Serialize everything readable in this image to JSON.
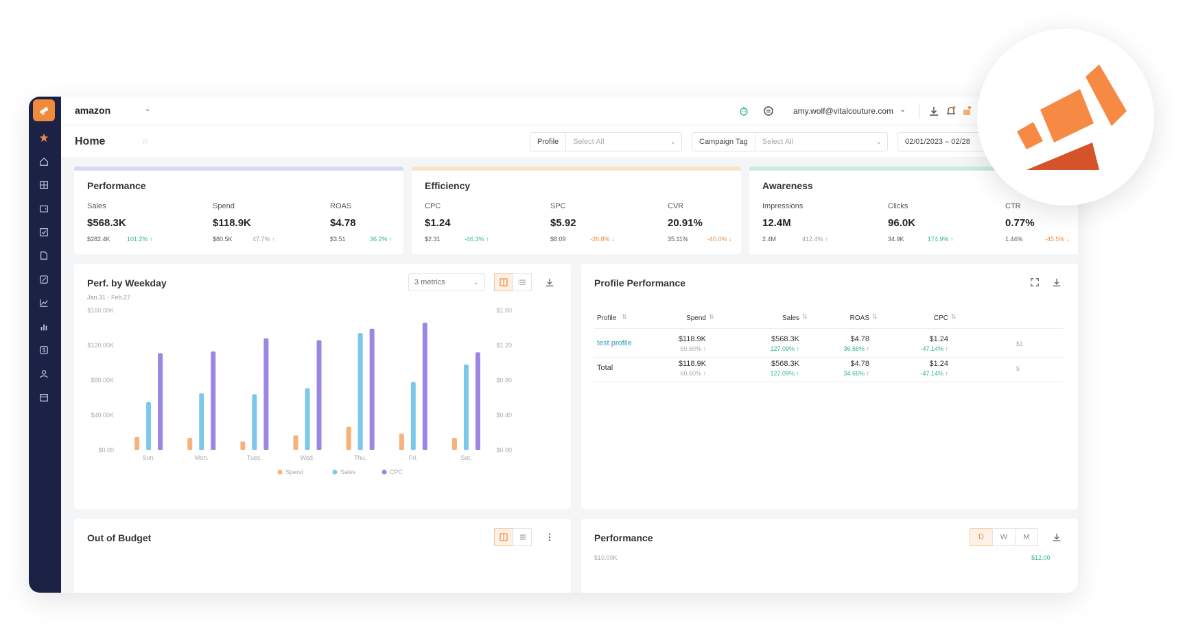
{
  "topbar": {
    "brand": "amazon",
    "email": "amy.wolf@vitalcouture.com"
  },
  "subbar": {
    "title": "Home",
    "filters": [
      {
        "label": "Profile",
        "value": "Select All"
      },
      {
        "label": "Campaign Tag",
        "value": "Select All"
      }
    ],
    "date_range": "02/01/2023 – 02/28"
  },
  "kpi_cards": [
    {
      "title": "Performance",
      "strip_color": "#d9d8f2",
      "metrics": [
        {
          "label": "Sales",
          "value": "$568.3K",
          "prev": "$282.4K",
          "change": "101.2%",
          "dir": "up"
        },
        {
          "label": "Spend",
          "value": "$118.9K",
          "prev": "$80.5K",
          "change": "47.7%",
          "dir": "neutral"
        },
        {
          "label": "ROAS",
          "value": "$4.78",
          "prev": "$3.51",
          "change": "36.2%",
          "dir": "up"
        }
      ]
    },
    {
      "title": "Efficiency",
      "strip_color": "#fbe3c9",
      "metrics": [
        {
          "label": "CPC",
          "value": "$1.24",
          "prev": "$2.31",
          "change": "-46.3%",
          "dir": "up"
        },
        {
          "label": "SPC",
          "value": "$5.92",
          "prev": "$8.09",
          "change": "-26.8%",
          "dir": "down"
        },
        {
          "label": "CVR",
          "value": "20.91%",
          "prev": "35.11%",
          "change": "-40.0%",
          "dir": "down"
        }
      ]
    },
    {
      "title": "Awareness",
      "strip_color": "#c9ecdc",
      "metrics": [
        {
          "label": "Impressions",
          "value": "12.4M",
          "prev": "2.4M",
          "change": "412.4%",
          "dir": "neutral"
        },
        {
          "label": "Clicks",
          "value": "96.0K",
          "prev": "34.9K",
          "change": "174.9%",
          "dir": "up"
        },
        {
          "label": "CTR",
          "value": "0.77%",
          "prev": "1.44%",
          "change": "-45.5%",
          "dir": "down"
        }
      ]
    }
  ],
  "weekday": {
    "title": "Perf. by Weekday",
    "subtitle": "Jan.31 - Feb.27",
    "metrics_dropdown": "3 metrics"
  },
  "chart_data": {
    "type": "bar",
    "categories": [
      "Sun.",
      "Mon.",
      "Tues.",
      "Wed.",
      "Thu.",
      "Fri.",
      "Sat."
    ],
    "series": [
      {
        "name": "Spend",
        "color": "#f6b27a",
        "axis": "left",
        "values": [
          15000,
          14000,
          10000,
          17000,
          27000,
          19000,
          14000
        ]
      },
      {
        "name": "Sales",
        "color": "#7cc8ea",
        "axis": "left",
        "values": [
          55000,
          65000,
          64000,
          71000,
          134000,
          78000,
          98000
        ]
      },
      {
        "name": "CPC",
        "color": "#9b86e3",
        "axis": "right",
        "values": [
          1.11,
          1.13,
          1.28,
          1.26,
          1.39,
          1.46,
          1.12
        ]
      }
    ],
    "y_left_ticks": [
      "$0.00",
      "$40.00K",
      "$80.00K",
      "$120.00K",
      "$160.00K"
    ],
    "y_right_ticks": [
      "$0.00",
      "$0.40",
      "$0.80",
      "$1.20",
      "$1.60"
    ],
    "ylim_left": [
      0,
      160000
    ],
    "ylim_right": [
      0,
      1.6
    ]
  },
  "profile_perf": {
    "title": "Profile Performance",
    "headers": [
      "Profile",
      "Spend",
      "Sales",
      "ROAS",
      "CPC"
    ],
    "rows": [
      {
        "name": "test profile",
        "spend": "$118.9K",
        "spend_chg": "60.60%",
        "sales": "$568.3K",
        "sales_chg": "127.09%",
        "roas": "$4.78",
        "roas_chg": "36.66%",
        "cpc": "$1.24",
        "cpc_chg": "-47.14%",
        "extra": "$1"
      },
      {
        "name": "Total",
        "spend": "$118.9K",
        "spend_chg": "60.60%",
        "sales": "$568.3K",
        "sales_chg": "127.09%",
        "roas": "$4.78",
        "roas_chg": "34.66%",
        "cpc": "$1.24",
        "cpc_chg": "-47.14%",
        "extra": "$"
      }
    ]
  },
  "out_of_budget": {
    "title": "Out of Budget"
  },
  "performance2": {
    "title": "Performance",
    "range_buttons": [
      "D",
      "W",
      "M"
    ],
    "y_left_top": "$10.00K",
    "y_right_top": "$12.00"
  },
  "colors": {
    "sidebar": "#1b2246",
    "accent": "#f08a3c",
    "positive": "#2fb883"
  }
}
